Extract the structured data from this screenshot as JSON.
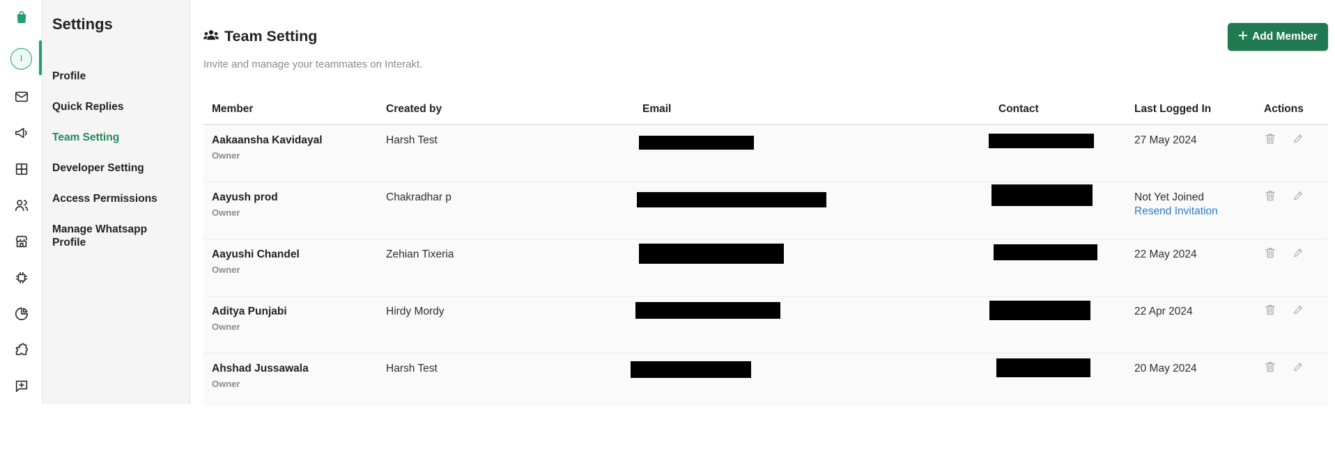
{
  "sidebar": {
    "title": "Settings",
    "items": [
      {
        "label": "Profile",
        "active": false
      },
      {
        "label": "Quick Replies",
        "active": false
      },
      {
        "label": "Team Setting",
        "active": true
      },
      {
        "label": "Developer Setting",
        "active": false
      },
      {
        "label": "Access Permissions",
        "active": false
      },
      {
        "label": "Manage Whatsapp Profile",
        "active": false
      }
    ]
  },
  "rail": {
    "avatar_initial": "I",
    "icons": [
      "shopping-bag-icon",
      "mail-icon",
      "megaphone-icon",
      "grid-icon",
      "users-icon",
      "store-icon",
      "chip-icon",
      "pie-chart-icon",
      "puzzle-icon",
      "message-plus-icon"
    ]
  },
  "header": {
    "title": "Team Setting",
    "subtitle": "Invite and manage your teammates on Interakt.",
    "add_button": "Add Member"
  },
  "table": {
    "columns": [
      "Member",
      "Created by",
      "Email",
      "Contact",
      "Last Logged In",
      "Actions"
    ],
    "rows": [
      {
        "name": "Aakaansha Kavidayal",
        "role": "Owner",
        "created_by": "Harsh Test",
        "last_logged_in": "27 May 2024",
        "resend": ""
      },
      {
        "name": "Aayush prod",
        "role": "Owner",
        "created_by": "Chakradhar p",
        "last_logged_in": "Not Yet Joined",
        "resend": "Resend Invitation"
      },
      {
        "name": "Aayushi Chandel",
        "role": "Owner",
        "created_by": "Zehian Tixeria",
        "last_logged_in": "22 May 2024",
        "resend": ""
      },
      {
        "name": "Aditya Punjabi",
        "role": "Owner",
        "created_by": "Hirdy Mordy",
        "last_logged_in": "22 Apr 2024",
        "resend": ""
      },
      {
        "name": "Ahshad Jussawala",
        "role": "Owner",
        "created_by": "Harsh Test",
        "last_logged_in": "20 May 2024",
        "resend": ""
      }
    ]
  },
  "colors": {
    "accent": "#1f9e72",
    "button": "#207a51",
    "link": "#2a7bd3"
  }
}
